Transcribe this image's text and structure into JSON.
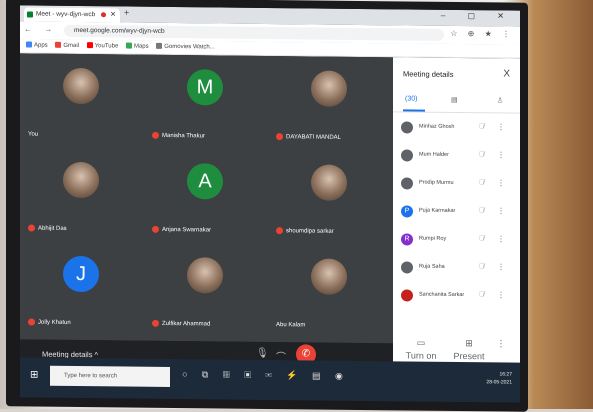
{
  "browser": {
    "tab_title": "Meet - wyv-djyn-wcb",
    "close": "✕",
    "new_tab": "+",
    "window_controls": "–  ▢  ✕",
    "nav": "←  →  C",
    "url": "meet.google.com/wyv-djyn-wcb",
    "url_icons": "☆ ⊕ ★ ⋮",
    "bookmarks": [
      "Apps",
      "Gmail",
      "YouTube",
      "Maps",
      "Gomovies Watch..."
    ]
  },
  "tiles": [
    {
      "name": "You",
      "initial": "",
      "avatar_type": "photo"
    },
    {
      "name": "Manisha Thakur",
      "initial": "M",
      "color": "#1e8e3e"
    },
    {
      "name": "DAYABATI MANDAL",
      "initial": "",
      "avatar_type": "photo"
    },
    {
      "name": "Abhijit Das",
      "initial": "",
      "avatar_type": "photo"
    },
    {
      "name": "Anjana Swarnakar",
      "initial": "A",
      "color": "#1e8e3e"
    },
    {
      "name": "shoumdipa sarkar",
      "initial": "",
      "avatar_type": "photo"
    },
    {
      "name": "Jolly Khatun",
      "initial": "J",
      "color": "#1a73e8"
    },
    {
      "name": "Zulfikar Ahammad",
      "initial": "",
      "avatar_type": "photo"
    },
    {
      "name": "Abu Kalam",
      "initial": "",
      "avatar_type": "photo"
    }
  ],
  "bottombar": {
    "meeting_details": "Meeting details ^",
    "mic": "🎙",
    "cam": "⌒",
    "end": "✆"
  },
  "panel": {
    "title": "Meeting details",
    "close": "X",
    "tab_people": "(30)",
    "tab_chat": "▤",
    "tab_activities": "♙",
    "participants": [
      {
        "name": "Minhaz Ghosh",
        "initial": "",
        "color": "#5f6368"
      },
      {
        "name": "Mum Halder",
        "initial": "",
        "color": "#5f6368"
      },
      {
        "name": "Prodip Murmu",
        "initial": "",
        "color": "#5f6368"
      },
      {
        "name": "Puja Karmakar",
        "initial": "P",
        "color": "#1a73e8"
      },
      {
        "name": "Rumpi Roy",
        "initial": "R",
        "color": "#8430ce"
      },
      {
        "name": "Ruja Saha",
        "initial": "",
        "color": "#5f6368"
      },
      {
        "name": "Sanchanita Sarkar",
        "initial": "",
        "color": "#c5221f"
      }
    ],
    "mic_muted": "🎙̸",
    "more": "⋮",
    "turn_on_captions": "Turn on captions",
    "present_now": "Present now"
  },
  "taskbar": {
    "start": "⊞",
    "search_placeholder": "Type here to search",
    "icons": "○ ⧉ ▦ ▣ ✉ ⚡ ▤ ◉",
    "time": "16:27",
    "date": "28-05-2021"
  }
}
